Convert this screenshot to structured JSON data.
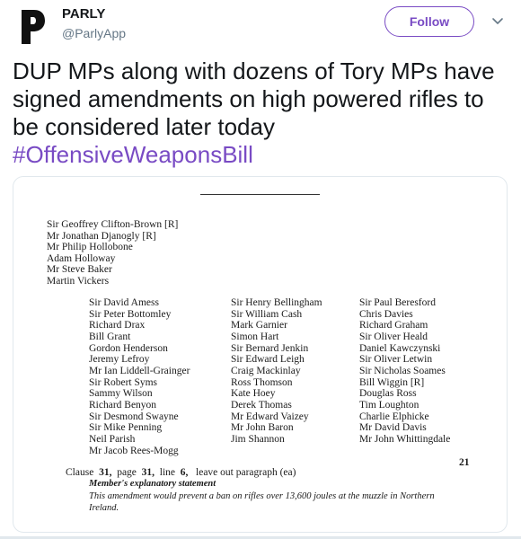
{
  "author": {
    "name": "PARLY",
    "handle": "@ParlyApp",
    "avatar_icon": "parly-logo-icon"
  },
  "follow_button": {
    "label": "Follow",
    "color": "#794bc4"
  },
  "more_menu": {
    "icon": "chevron-down-icon"
  },
  "tweet": {
    "text": "DUP MPs along with dozens of Tory MPs have signed amendments on high powered rifles to be considered later today",
    "hashtag": "#OffensiveWeaponsBill",
    "hashtag_color": "#794bc4"
  },
  "document": {
    "lead_signatories": [
      "Sir Geoffrey Clifton-Brown [R]",
      "Mr Jonathan Djanogly [R]",
      "Mr Philip Hollobone",
      "Adam Holloway",
      "Mr Steve Baker",
      "Martin Vickers"
    ],
    "columns": [
      [
        "Sir David Amess",
        "Sir Peter Bottomley",
        "Richard Drax",
        "Bill Grant",
        "Gordon Henderson",
        "Jeremy Lefroy",
        "Mr Ian Liddell-Grainger",
        "Sir Robert Syms",
        "Sammy Wilson",
        "Richard Benyon",
        "Sir Desmond Swayne",
        "Sir Mike Penning",
        "Neil Parish",
        "Mr Jacob Rees-Mogg"
      ],
      [
        "Sir Henry Bellingham",
        "Sir William Cash",
        "Mark Garnier",
        "Simon Hart",
        "Sir Bernard Jenkin",
        "Sir Edward Leigh",
        "Craig Mackinlay",
        "Ross Thomson",
        "Kate Hoey",
        "Derek Thomas",
        "Mr Edward Vaizey",
        "Mr John Baron",
        "Jim Shannon"
      ],
      [
        "Sir Paul Beresford",
        "Chris Davies",
        "Richard Graham",
        "Sir Oliver Heald",
        "Daniel Kawczynski",
        "Sir Oliver Letwin",
        "Sir Nicholas Soames",
        "Bill Wiggin [R]",
        "Douglas Ross",
        "Tim Loughton",
        "Charlie Elphicke",
        "Mr David Davis",
        "Mr John Whittingdale"
      ]
    ],
    "page_number": "21",
    "clause": {
      "clause_label": "Clause",
      "clause_num": "31,",
      "page_label": "page",
      "page_num": "31,",
      "line_label": "line",
      "line_num": "6,",
      "instruction": "leave out paragraph (ea)"
    },
    "explanatory_heading": "Member's explanatory statement",
    "explanatory_text": "This amendment would prevent a ban on rifles over 13,600 joules at the muzzle in Northern Ireland."
  }
}
